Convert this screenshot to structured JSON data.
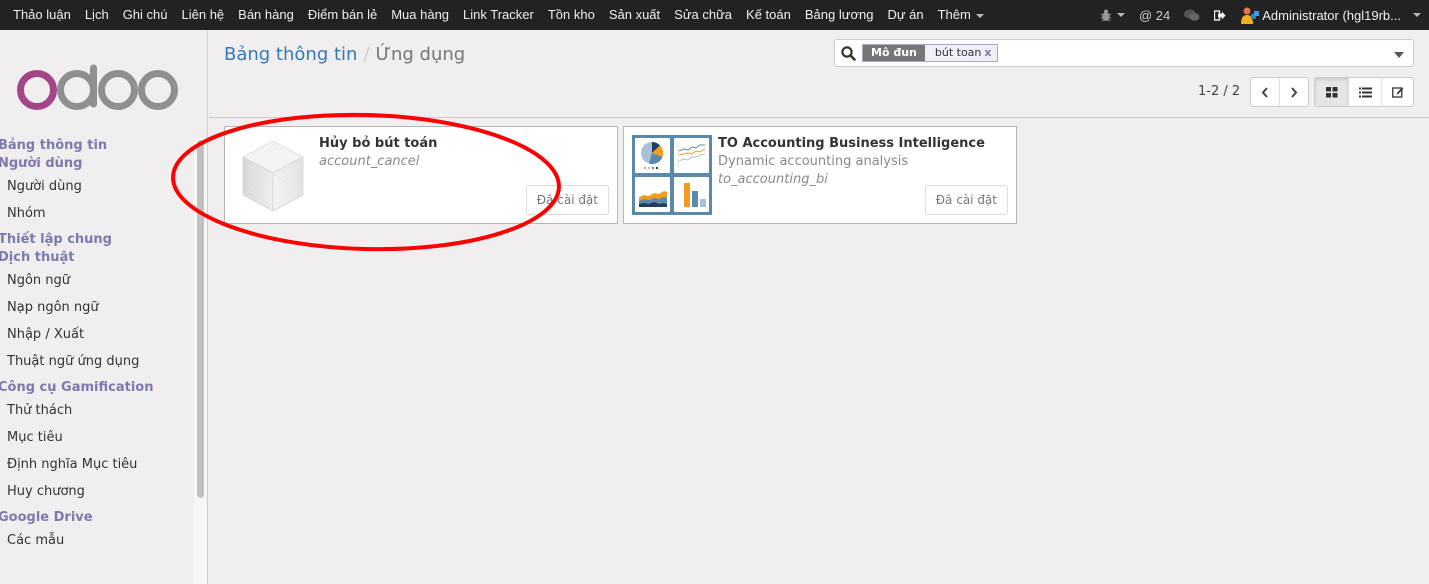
{
  "topbar": {
    "menu": [
      "Thảo luận",
      "Lịch",
      "Ghi chú",
      "Liên hệ",
      "Bán hàng",
      "Điểm bán lẻ",
      "Mua hàng",
      "Link Tracker",
      "Tồn kho",
      "Sản xuất",
      "Sửa chữa",
      "Kế toán",
      "Bảng lương",
      "Dự án"
    ],
    "more_label": "Thêm",
    "mentions_count": "@ 24",
    "user_label": "Administrator (hgl19rb..."
  },
  "sidebar": {
    "sections": [
      {
        "header": "Bảng thông tin",
        "items": []
      },
      {
        "header": "Người dùng",
        "items": [
          "Người dùng",
          "Nhóm"
        ]
      },
      {
        "header": "Thiết lập chung",
        "items": []
      },
      {
        "header": "Dịch thuật",
        "items": [
          "Ngôn ngữ",
          "Nạp ngôn ngữ",
          "Nhập / Xuất",
          "Thuật ngữ ứng dụng"
        ]
      },
      {
        "header": "Công cụ Gamification",
        "items": [
          "Thử thách",
          "Mục tiêu",
          "Định nghĩa Mục tiêu",
          "Huy chương"
        ]
      },
      {
        "header": "Google Drive",
        "items": [
          "Các mẫu"
        ]
      }
    ]
  },
  "breadcrumb": {
    "parent": "Bảng thông tin",
    "separator": "/",
    "current": "Ứng dụng"
  },
  "search": {
    "facet_label": "Mô đun",
    "facet_value": "bút toan",
    "facet_remove": "x"
  },
  "pager": {
    "text": "1-2 / 2"
  },
  "modules": [
    {
      "title": "Hủy bỏ bút toán",
      "summary": "",
      "technical_name": "account_cancel",
      "status": "Đã cài đặt",
      "icon": "default-module-cube-icon"
    },
    {
      "title": "TO Accounting Business Intelligence",
      "summary": "Dynamic accounting analysis",
      "technical_name": "to_accounting_bi",
      "status": "Đã cài đặt",
      "icon": "charts-icon"
    }
  ],
  "annotation": {
    "color": "#ff0000",
    "shape": "ellipse",
    "target": "Hủy bỏ bút toán"
  },
  "colors": {
    "topbar": "#222222",
    "sidebar_header": "#7c7bad",
    "link": "#337ab7",
    "background": "#f0eeee"
  }
}
